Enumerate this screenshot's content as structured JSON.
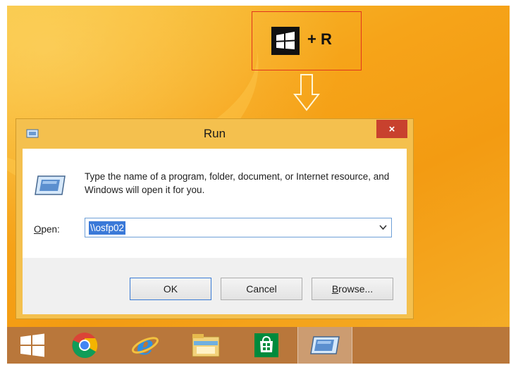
{
  "hint": {
    "shortcut_text": "+ R",
    "icon": "windows-logo-icon"
  },
  "dialog": {
    "title": "Run",
    "close_label": "×",
    "description": "Type the name of a program, folder, document, or Internet resource, and Windows will open it for you.",
    "open_label_accel": "O",
    "open_label_rest": "pen:",
    "open_value": "\\\\osfp02",
    "buttons": {
      "ok": "OK",
      "cancel": "Cancel",
      "browse_accel": "B",
      "browse_rest": "rowse..."
    }
  },
  "taskbar": {
    "items": [
      {
        "icon": "start-windows-icon"
      },
      {
        "icon": "chrome-icon"
      },
      {
        "icon": "internet-explorer-icon"
      },
      {
        "icon": "file-explorer-icon"
      },
      {
        "icon": "store-icon"
      },
      {
        "icon": "run-program-icon",
        "active": true
      }
    ]
  },
  "colors": {
    "desktop": "#f6a419",
    "highlight_box": "#e0341e",
    "close_button": "#c8412e",
    "selection": "#3a79d8",
    "taskbar": "#b9773b"
  }
}
